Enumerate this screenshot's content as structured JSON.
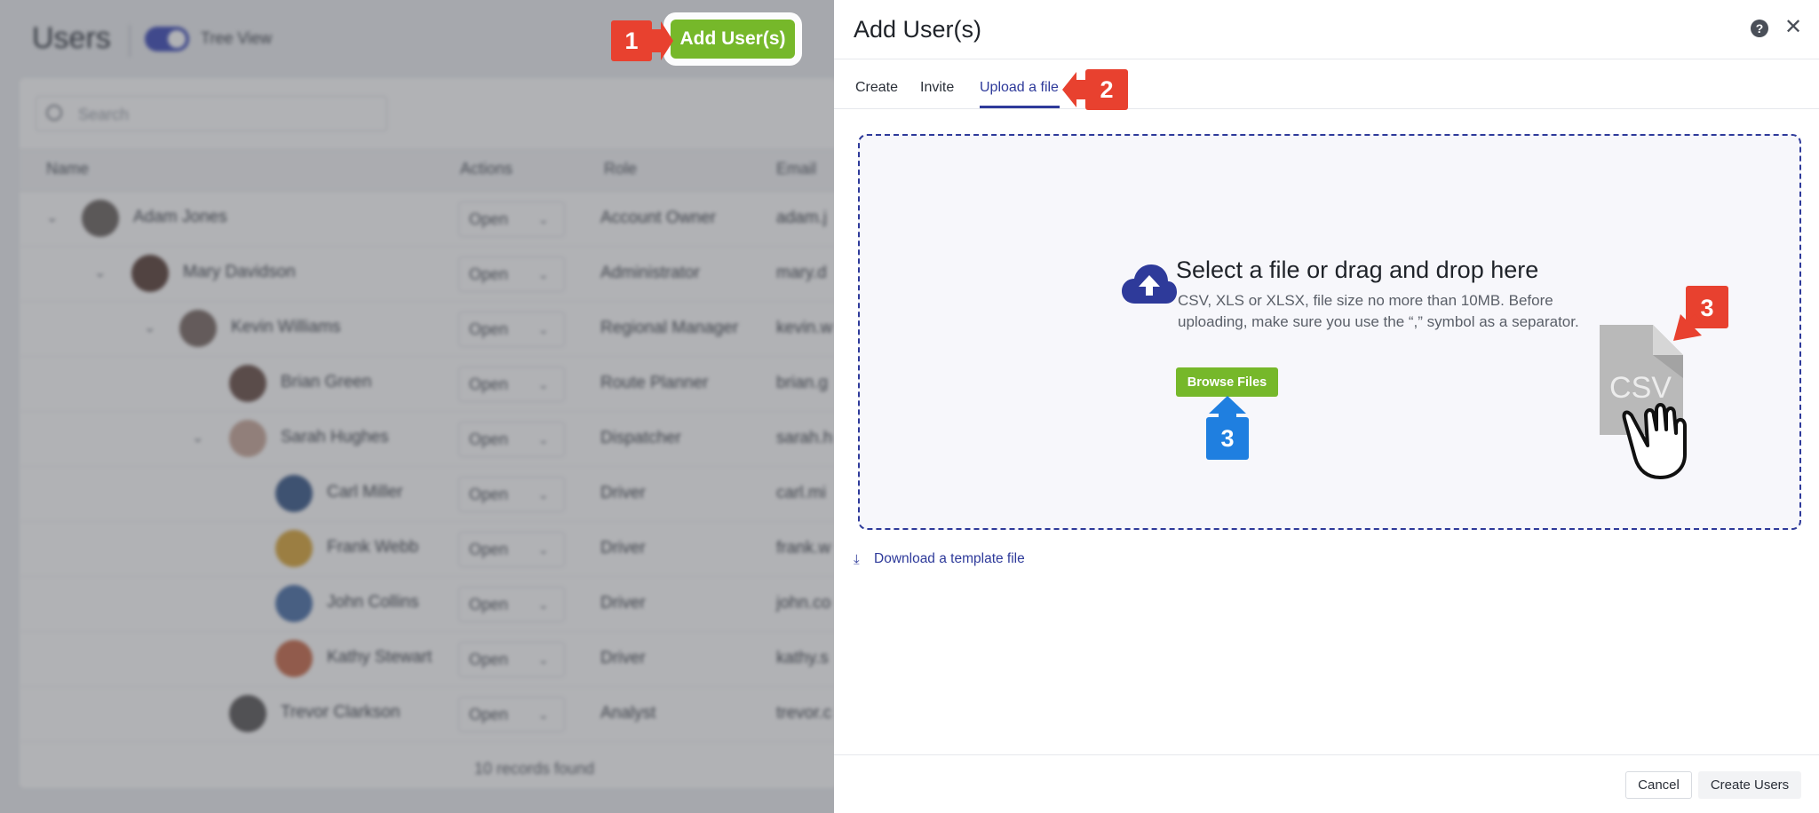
{
  "background": {
    "page_title": "Users",
    "tree_view_label": "Tree View",
    "search_placeholder": "Search",
    "columns": [
      "Name",
      "Actions",
      "Role",
      "Email"
    ],
    "rows": [
      {
        "name": "Adam Jones",
        "action": "Open",
        "role": "Account Owner",
        "email": "adam.j"
      },
      {
        "name": "Mary Davidson",
        "action": "Open",
        "role": "Administrator",
        "email": "mary.d"
      },
      {
        "name": "Kevin Williams",
        "action": "Open",
        "role": "Regional Manager",
        "email": "kevin.w"
      },
      {
        "name": "Brian Green",
        "action": "Open",
        "role": "Route Planner",
        "email": "brian.g"
      },
      {
        "name": "Sarah Hughes",
        "action": "Open",
        "role": "Dispatcher",
        "email": "sarah.h"
      },
      {
        "name": "Carl Miller",
        "action": "Open",
        "role": "Driver",
        "email": "carl.mi"
      },
      {
        "name": "Frank Webb",
        "action": "Open",
        "role": "Driver",
        "email": "frank.w"
      },
      {
        "name": "John Collins",
        "action": "Open",
        "role": "Driver",
        "email": "john.co"
      },
      {
        "name": "Kathy Stewart",
        "action": "Open",
        "role": "Driver",
        "email": "kathy.s"
      },
      {
        "name": "Trevor Clarkson",
        "action": "Open",
        "role": "Analyst",
        "email": "trevor.c"
      }
    ],
    "footer_text": "10 records found"
  },
  "add_users_button": "Add User(s)",
  "callouts": {
    "one": "1",
    "two": "2",
    "three": "3"
  },
  "drawer": {
    "title": "Add User(s)",
    "help_icon": "?",
    "close_icon": "✕",
    "tabs": [
      {
        "label": "Create",
        "active": false
      },
      {
        "label": "Invite",
        "active": false
      },
      {
        "label": "Upload a file",
        "active": true
      }
    ],
    "dropzone": {
      "title": "Select a file or drag and drop here",
      "description": "CSV, XLS or XLSX, file size no more than 10MB. Before uploading, make sure you use the “,” symbol as a separator.",
      "browse_button": "Browse Files",
      "file_badge": "CSV"
    },
    "download_link": "Download a template file",
    "footer": {
      "cancel": "Cancel",
      "create": "Create Users"
    }
  },
  "colors": {
    "accent_green": "#76b82a",
    "accent_blue": "#2e3a9a",
    "callout_red": "#e8412f",
    "callout_blue": "#1f7fe0"
  }
}
